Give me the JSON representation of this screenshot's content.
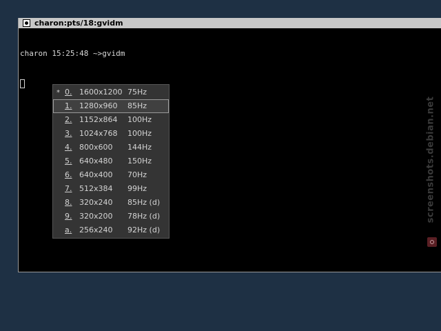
{
  "window": {
    "title": "charon:pts/18:gvidm"
  },
  "terminal": {
    "prompt_line": "charon 15:25:48 ~>gvidm"
  },
  "menu": {
    "items": [
      {
        "mark": "*",
        "key": "0",
        "sep": ".",
        "resolution": "1600x1200",
        "rate": "75Hz",
        "selected": false
      },
      {
        "mark": "",
        "key": "1",
        "sep": ".",
        "resolution": "1280x960",
        "rate": "85Hz",
        "selected": true
      },
      {
        "mark": "",
        "key": "2",
        "sep": ".",
        "resolution": "1152x864",
        "rate": "100Hz",
        "selected": false
      },
      {
        "mark": "",
        "key": "3",
        "sep": ".",
        "resolution": "1024x768",
        "rate": "100Hz",
        "selected": false
      },
      {
        "mark": "",
        "key": "4",
        "sep": ".",
        "resolution": "800x600",
        "rate": "144Hz",
        "selected": false
      },
      {
        "mark": "",
        "key": "5",
        "sep": ".",
        "resolution": "640x480",
        "rate": "150Hz",
        "selected": false
      },
      {
        "mark": "",
        "key": "6",
        "sep": ".",
        "resolution": "640x400",
        "rate": "70Hz",
        "selected": false
      },
      {
        "mark": "",
        "key": "7",
        "sep": ".",
        "resolution": "512x384",
        "rate": "99Hz",
        "selected": false
      },
      {
        "mark": "",
        "key": "8",
        "sep": ".",
        "resolution": "320x240",
        "rate": "85Hz (d)",
        "selected": false
      },
      {
        "mark": "",
        "key": "9",
        "sep": ".",
        "resolution": "320x200",
        "rate": "78Hz (d)",
        "selected": false
      },
      {
        "mark": "",
        "key": "a",
        "sep": ".",
        "resolution": "256x240",
        "rate": "92Hz (d)",
        "selected": false
      }
    ]
  },
  "watermark": {
    "text": "screenshots.debian.net"
  },
  "colors": {
    "desktop": "#1e3044",
    "terminal_bg": "#000000",
    "menu_bg": "#343434",
    "titlebar_bg": "#c8c8c8"
  }
}
